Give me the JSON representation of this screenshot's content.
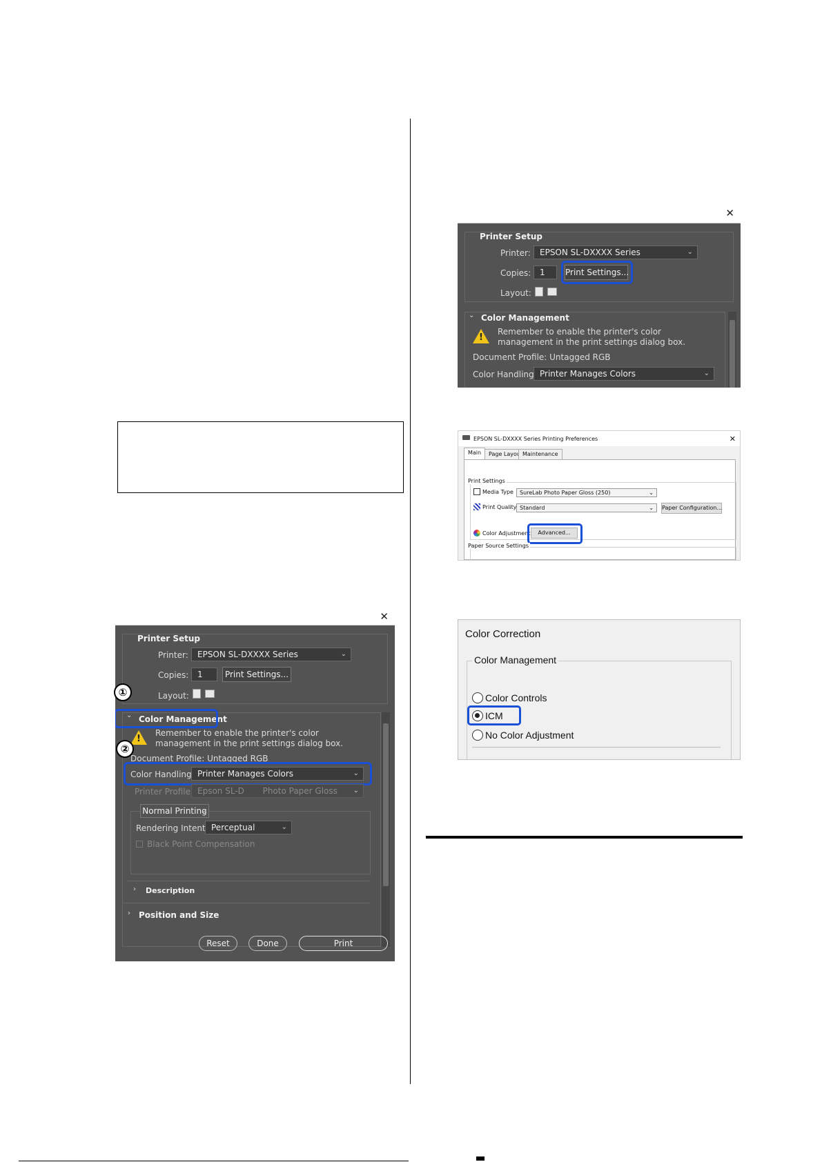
{
  "dialog_main": {
    "section_printer_setup": "Printer Setup",
    "printer_label": "Printer:",
    "printer_value": "EPSON SL-DXXXX Series",
    "copies_label": "Copies:",
    "copies_value": "1",
    "print_settings_button": "Print Settings...",
    "layout_label": "Layout:",
    "section_color_management": "Color Management",
    "warning_text_1": "Remember to enable the printer's color",
    "warning_text_2": "management in the print settings dialog box.",
    "document_profile": "Document Profile: Untagged RGB",
    "color_handling_label": "Color Handling:",
    "color_handling_value": "Printer Manages Colors",
    "printer_profile_label": "Printer Profile:",
    "printer_profile_value": "Epson SL-D       Photo Paper Gloss",
    "normal_printing": "Normal Printing",
    "rendering_intent_label": "Rendering Intent:",
    "rendering_intent_value": "Perceptual",
    "black_point": "Black Point Compensation",
    "description": "Description",
    "position_size": "Position and Size",
    "reset_button": "Reset",
    "done_button": "Done",
    "print_button": "Print",
    "close": "✕",
    "step1": "①",
    "step2": "②"
  },
  "dialog_top": {
    "section_printer_setup": "Printer Setup",
    "printer_label": "Printer:",
    "printer_value": "EPSON SL-DXXXX Series",
    "copies_label": "Copies:",
    "copies_value": "1",
    "print_settings_button": "Print Settings...",
    "layout_label": "Layout:",
    "section_color_management": "Color Management",
    "warning_text_1": "Remember to enable the printer's color",
    "warning_text_2": "management in the print settings dialog box.",
    "document_profile": "Document Profile: Untagged RGB",
    "color_handling_label": "Color Handling:",
    "color_handling_value": "Printer Manages Colors",
    "close": "✕"
  },
  "prefs": {
    "title": "EPSON SL-DXXXX Series Printing Preferences",
    "close": "✕",
    "tabs": [
      "Main",
      "Page Layout",
      "Maintenance"
    ],
    "print_settings": "Print Settings",
    "media_type_label": "Media Type",
    "media_type_value": "SureLab Photo Paper Gloss (250)",
    "print_quality_label": "Print Quality",
    "print_quality_value": "Standard",
    "paper_config_button": "Paper Configuration...",
    "color_adjustment_label": "Color Adjustment",
    "advanced_button": "Advanced...",
    "paper_source": "Paper Source Settings"
  },
  "color_correction": {
    "title": "Color Correction",
    "group": "Color Management",
    "options": [
      "Color Controls",
      "ICM",
      "No Color Adjustment"
    ]
  },
  "colors": {
    "highlight": "#1a4fd6",
    "dialog_bg": "#535353",
    "warning": "#f0c419"
  }
}
